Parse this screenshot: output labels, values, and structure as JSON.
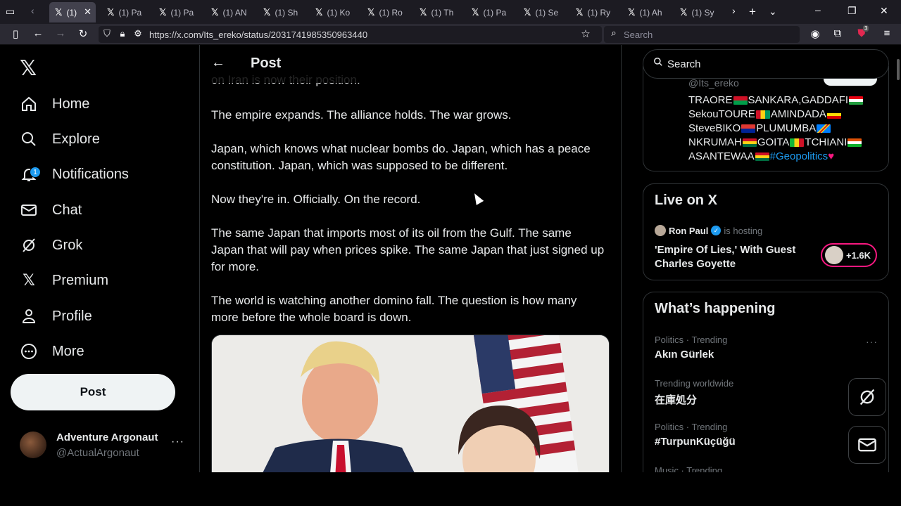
{
  "browser": {
    "tabs": [
      {
        "label": "(1)",
        "active": true
      },
      {
        "label": "(1) Pa"
      },
      {
        "label": "(1) Pa"
      },
      {
        "label": "(1) AN"
      },
      {
        "label": "(1) Sh"
      },
      {
        "label": "(1) Ko"
      },
      {
        "label": "(1) Ro"
      },
      {
        "label": "(1) Th"
      },
      {
        "label": "(1) Pa"
      },
      {
        "label": "(1) Se"
      },
      {
        "label": "(1) Ry"
      },
      {
        "label": "(1) Ah"
      },
      {
        "label": "(1) Sy"
      }
    ],
    "url": "https://x.com/Its_ereko/status/2031741985350963440",
    "search_placeholder": "Search",
    "extension_badge": "3"
  },
  "nav": {
    "logo": "X",
    "items": [
      {
        "label": "Home",
        "icon": "home-icon"
      },
      {
        "label": "Explore",
        "icon": "search-icon"
      },
      {
        "label": "Notifications",
        "icon": "bell-icon",
        "badge": "1"
      },
      {
        "label": "Chat",
        "icon": "mail-icon"
      },
      {
        "label": "Grok",
        "icon": "grok-icon"
      },
      {
        "label": "Premium",
        "icon": "x-icon"
      },
      {
        "label": "Profile",
        "icon": "person-icon"
      },
      {
        "label": "More",
        "icon": "more-circle-icon"
      }
    ],
    "post_label": "Post",
    "account": {
      "name": "Adventure Argonaut",
      "handle": "@ActualArgonaut"
    }
  },
  "main": {
    "header_title": "Post",
    "partial_line": "on Iran is now their position.",
    "paragraphs": [
      "The empire expands. The alliance holds. The war grows.",
      "Japan, which knows what nuclear bombs do. Japan, which has a peace constitution. Japan, which was supposed to be different.",
      "Now they're in. Officially. On the record.",
      "The same Japan that imports most of its oil from the Gulf. The same Japan that will pay when prices spike. The same Japan that just signed up for more.",
      "The world is watching another domino fall. The question is how many more before the whole board is down."
    ]
  },
  "sidebar": {
    "search_placeholder": "Search",
    "profile_card": {
      "handle": "@Its_ereko",
      "bio_lines": [
        {
          "parts": [
            "TRAORE",
            "SANKARA,GADDAFI"
          ]
        },
        {
          "parts": [
            "SekouTOURE",
            "AMINDADA"
          ]
        },
        {
          "parts": [
            "SteveBIKO",
            "PLUMUMBA"
          ]
        },
        {
          "parts": [
            "NKRUMAH",
            "GOITA",
            "TCHIANI"
          ]
        },
        {
          "parts": [
            "ASANTEWAA",
            "#Geopolitics"
          ]
        }
      ]
    },
    "live": {
      "title": "Live on X",
      "host_name": "Ron Paul",
      "host_text": "is hosting",
      "space_title": "'Empire Of Lies,' With Guest Charles Goyette",
      "listeners": "+1.6K"
    },
    "happening": {
      "title": "What’s happening",
      "trends": [
        {
          "meta": "Politics · Trending",
          "name": "Akın Gürlek"
        },
        {
          "meta": "Trending worldwide",
          "name": "在庫処分"
        },
        {
          "meta": "Politics · Trending",
          "name": "#TurpunKüçüğü"
        },
        {
          "meta": "Music · Trending",
          "name": ""
        }
      ]
    }
  },
  "colors": {
    "accent": "#1d9bf0",
    "live_ring": "#f91880",
    "background": "#000000"
  }
}
